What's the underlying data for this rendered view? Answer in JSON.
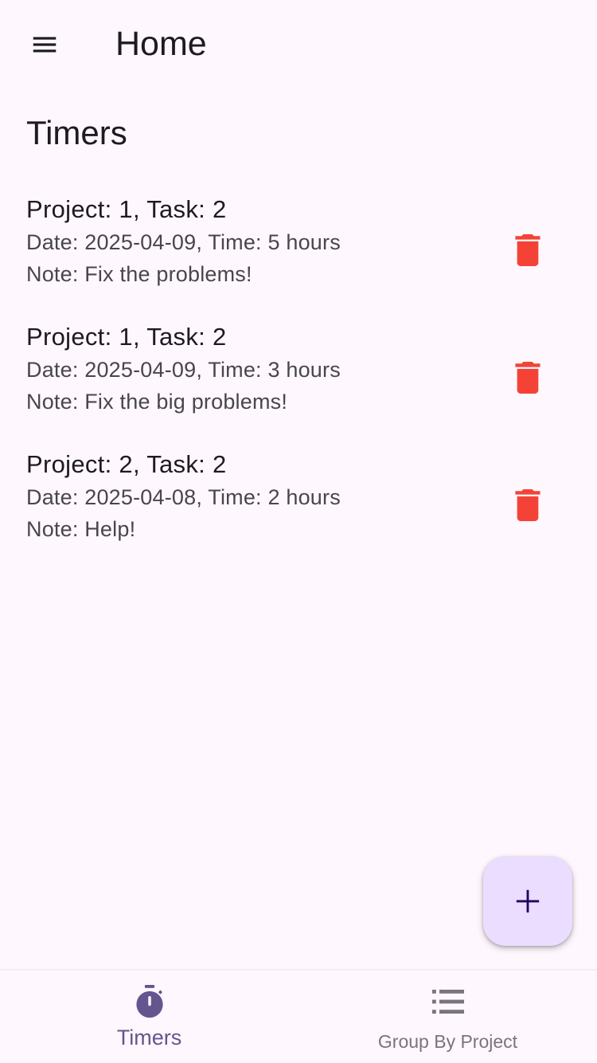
{
  "appbar": {
    "title": "Home",
    "menu_icon": "menu-icon"
  },
  "section": {
    "title": "Timers"
  },
  "timers": [
    {
      "title": "Project: 1, Task: 2",
      "details": "Date: 2025-04-09, Time: 5 hours",
      "note": "Note: Fix the problems!"
    },
    {
      "title": "Project: 1, Task: 2",
      "details": "Date: 2025-04-09, Time: 3 hours",
      "note": "Note: Fix the big problems!"
    },
    {
      "title": "Project: 2, Task: 2",
      "details": "Date: 2025-04-08, Time: 2 hours",
      "note": "Note: Help!"
    }
  ],
  "fab": {
    "icon": "add-icon"
  },
  "bottom_nav": {
    "items": [
      {
        "label": "Timers",
        "icon": "timer-icon",
        "selected": true
      },
      {
        "label": "Group By Project",
        "icon": "list-icon",
        "selected": false
      }
    ]
  },
  "colors": {
    "background": "#fef7fd",
    "delete": "#f44336",
    "fab_bg": "#eaddff",
    "fab_icon": "#21005d",
    "nav_selected": "#65558f",
    "nav_unselected": "#79747e"
  }
}
